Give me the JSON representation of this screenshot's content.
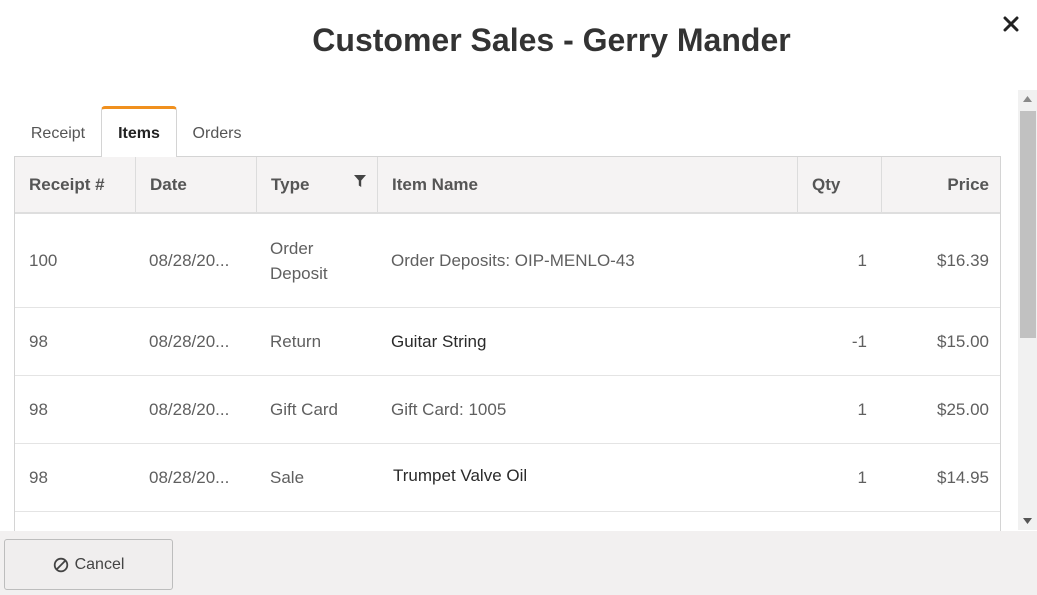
{
  "dialog": {
    "title": "Customer Sales - Gerry Mander",
    "close_icon": "close-icon"
  },
  "tabs": [
    {
      "label": "Receipt",
      "active": false
    },
    {
      "label": "Items",
      "active": true
    },
    {
      "label": "Orders",
      "active": false
    }
  ],
  "table": {
    "columns": [
      "Receipt #",
      "Date",
      "Type",
      "Item Name",
      "Qty",
      "Price"
    ],
    "type_filter_icon": "filter-icon",
    "rows": [
      {
        "receipt": "100",
        "date": "08/28/20...",
        "type": "Order Deposit",
        "item": "Order Deposits: OIP-MENLO-43",
        "qty": "1",
        "price": "$16.39"
      },
      {
        "receipt": "98",
        "date": "08/28/20...",
        "type": "Return",
        "item": "Guitar String",
        "qty": "-1",
        "price": "$15.00"
      },
      {
        "receipt": "98",
        "date": "08/28/20...",
        "type": "Gift Card",
        "item": "Gift Card: 1005",
        "qty": "1",
        "price": "$25.00"
      },
      {
        "receipt": "98",
        "date": "08/28/20...",
        "type": "Sale",
        "item": "Trumpet Valve Oil",
        "qty": "1",
        "price": "$14.95"
      }
    ]
  },
  "footer": {
    "cancel_label": "Cancel",
    "cancel_icon": "cancel-icon"
  },
  "colors": {
    "active_tab_accent": "#f0901e"
  }
}
